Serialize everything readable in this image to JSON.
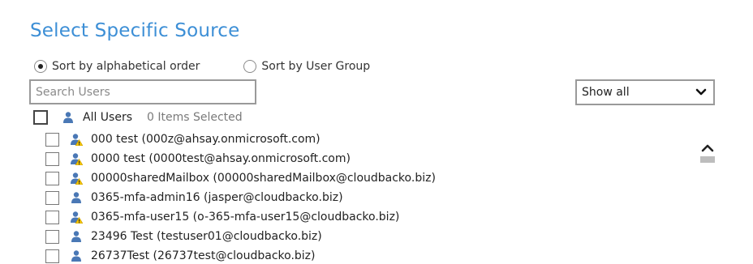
{
  "title": "Select Specific Source",
  "sort": {
    "option1": "Sort by alphabetical order",
    "option2": "Sort by User Group",
    "selected": "option1"
  },
  "search": {
    "placeholder": "Search Users",
    "value": ""
  },
  "filter": {
    "value": "Show all"
  },
  "all_users": {
    "label": "All Users",
    "count_text": "0 Items Selected"
  },
  "users": [
    {
      "label": "000 test (000z@ahsay.onmicrosoft.com)",
      "icon": "user-warning-icon"
    },
    {
      "label": "0000 test (0000test@ahsay.onmicrosoft.com)",
      "icon": "user-warning-icon"
    },
    {
      "label": "00000sharedMailbox (00000sharedMailbox@cloudbacko.biz)",
      "icon": "user-warning-icon"
    },
    {
      "label": "0365-mfa-admin16 (jasper@cloudbacko.biz)",
      "icon": "user-icon"
    },
    {
      "label": "0365-mfa-user15 (o-365-mfa-user15@cloudbacko.biz)",
      "icon": "user-warning-icon"
    },
    {
      "label": "23496 Test (testuser01@cloudbacko.biz)",
      "icon": "user-icon"
    },
    {
      "label": "26737Test (26737test@cloudbacko.biz)",
      "icon": "user-icon"
    }
  ],
  "colors": {
    "title": "#3d8fd6",
    "user_icon": "#4a78b5",
    "warning": "#f2c400"
  }
}
